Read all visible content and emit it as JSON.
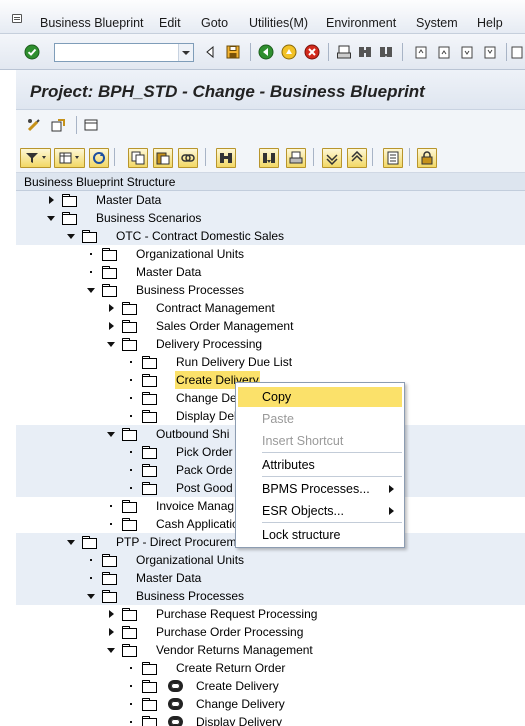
{
  "menu": {
    "items": [
      {
        "label": "Business Blueprint"
      },
      {
        "label": "Edit"
      },
      {
        "label": "Goto"
      },
      {
        "label": "Utilities(M)"
      },
      {
        "label": "Environment"
      },
      {
        "label": "System"
      },
      {
        "label": "Help"
      }
    ]
  },
  "command_field": {
    "value": ""
  },
  "title": "Project: BPH_STD - Change - Business Blueprint",
  "tree": {
    "header": "Business Blueprint Structure",
    "rows": [
      {
        "label": "Master Data"
      },
      {
        "label": "Business Scenarios"
      },
      {
        "label": "OTC - Contract Domestic Sales"
      },
      {
        "label": "Organizational Units"
      },
      {
        "label": "Master Data"
      },
      {
        "label": "Business Processes"
      },
      {
        "label": "Contract Management"
      },
      {
        "label": "Sales Order Management"
      },
      {
        "label": "Delivery Processing"
      },
      {
        "label": "Run Delivery Due List"
      },
      {
        "label": "Create Delivery"
      },
      {
        "label": "Change De"
      },
      {
        "label": "Display Del"
      },
      {
        "label": "Outbound Shi"
      },
      {
        "label": "Pick Order"
      },
      {
        "label": "Pack Orde"
      },
      {
        "label": "Post Good"
      },
      {
        "label": "Invoice Manag"
      },
      {
        "label": "Cash Applicatio"
      },
      {
        "label": "PTP - Direct Procuremen"
      },
      {
        "label": "Organizational Units"
      },
      {
        "label": "Master Data"
      },
      {
        "label": "Business Processes"
      },
      {
        "label": "Purchase Request Processing"
      },
      {
        "label": "Purchase Order Processing"
      },
      {
        "label": "Vendor Returns Management"
      },
      {
        "label": "Create Return Order"
      },
      {
        "label": "Create Delivery"
      },
      {
        "label": "Change Delivery"
      },
      {
        "label": "Display Delivery"
      }
    ]
  },
  "context_menu": {
    "items": [
      {
        "label": "Copy",
        "state": "highlighted"
      },
      {
        "label": "Paste",
        "state": "disabled"
      },
      {
        "label": "Insert Shortcut",
        "state": "disabled"
      },
      {
        "label": "Attributes",
        "state": "enabled"
      },
      {
        "label": "BPMS Processes...",
        "state": "enabled"
      },
      {
        "label": "ESR Objects...",
        "state": "enabled"
      },
      {
        "label": "Lock structure",
        "state": "enabled"
      }
    ]
  },
  "colors": {
    "selection": "#fbe16a",
    "title_bg": "#dfe6f0",
    "alt_row": "#e8eef6"
  }
}
